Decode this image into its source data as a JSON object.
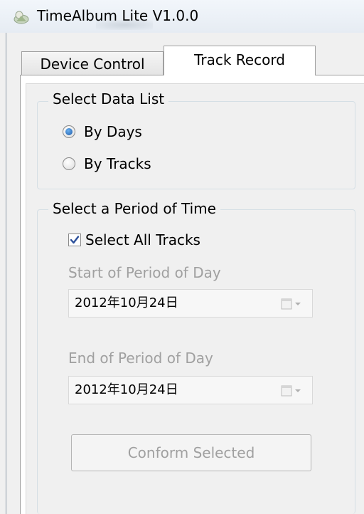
{
  "window": {
    "title": "TimeAlbum Lite V1.0.0"
  },
  "tabs": [
    {
      "label": "Device Control",
      "active": false
    },
    {
      "label": "Track Record",
      "active": true
    }
  ],
  "data_list_group": {
    "legend": "Select Data List",
    "options": [
      {
        "label": "By Days",
        "checked": true
      },
      {
        "label": "By Tracks",
        "checked": false
      }
    ]
  },
  "period_group": {
    "legend": "Select a Period of Time",
    "select_all": {
      "label": "Select All Tracks",
      "checked": true
    },
    "start": {
      "label": "Start of Period of Day",
      "value": "2012年10月24日"
    },
    "end": {
      "label": "End of Period of Day",
      "value": "2012年10月24日"
    },
    "confirm_button": "Conform Selected"
  },
  "icons": {
    "app": "app-icon",
    "calendar": "calendar-icon",
    "dropdown": "chevron-down-icon",
    "check": "check-icon"
  },
  "colors": {
    "radio_accent": "#1d5aa8",
    "check_accent": "#2b4f9a",
    "disabled_text": "#a0a0a0"
  }
}
